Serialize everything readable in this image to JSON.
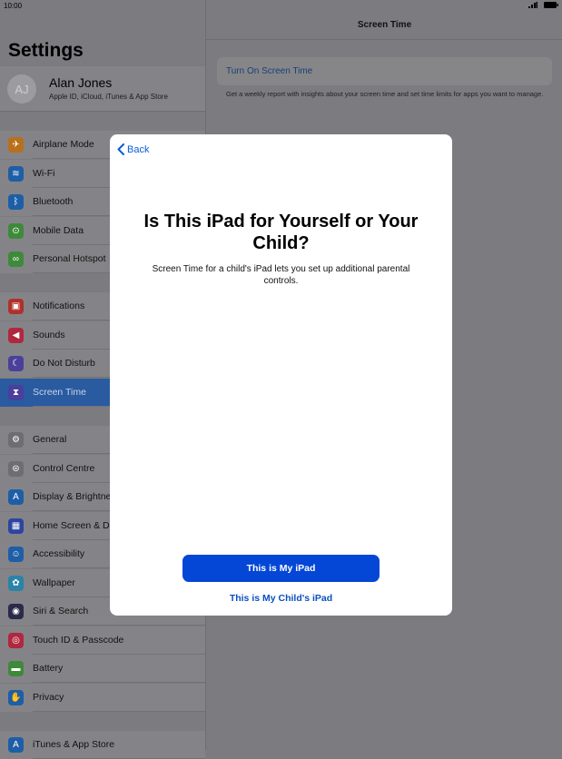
{
  "status": {
    "time": "10:00"
  },
  "sidebar": {
    "title": "Settings",
    "profile": {
      "initials": "AJ",
      "name": "Alan Jones",
      "subtitle": "Apple ID, iCloud, iTunes & App Store"
    },
    "items": [
      {
        "label": "Airplane Mode",
        "icon": "airplane-icon",
        "color": "#b8701a"
      },
      {
        "label": "Wi-Fi",
        "icon": "wifi-icon",
        "color": "#1e5ea6"
      },
      {
        "label": "Bluetooth",
        "icon": "bluetooth-icon",
        "color": "#1e5ea6"
      },
      {
        "label": "Mobile Data",
        "icon": "antenna-icon",
        "color": "#3f8a3a"
      },
      {
        "label": "Personal Hotspot",
        "icon": "hotspot-icon",
        "color": "#3f8a3a"
      },
      {
        "label": "Notifications",
        "icon": "notifications-icon",
        "color": "#b0302c"
      },
      {
        "label": "Sounds",
        "icon": "speaker-icon",
        "color": "#b0283e"
      },
      {
        "label": "Do Not Disturb",
        "icon": "moon-icon",
        "color": "#4a3f9a"
      },
      {
        "label": "Screen Time",
        "icon": "hourglass-icon",
        "color": "#4a3f9a"
      },
      {
        "label": "General",
        "icon": "gear-icon",
        "color": "#6e6e72"
      },
      {
        "label": "Control Centre",
        "icon": "switches-icon",
        "color": "#6e6e72"
      },
      {
        "label": "Display & Brightness",
        "icon": "display-icon",
        "color": "#1e5ea6"
      },
      {
        "label": "Home Screen & Dock",
        "icon": "grid-icon",
        "color": "#2c45a0"
      },
      {
        "label": "Accessibility",
        "icon": "accessibility-icon",
        "color": "#1e5ea6"
      },
      {
        "label": "Wallpaper",
        "icon": "flower-icon",
        "color": "#2a84a8"
      },
      {
        "label": "Siri & Search",
        "icon": "siri-icon",
        "color": "#2a2a4a"
      },
      {
        "label": "Touch ID & Passcode",
        "icon": "fingerprint-icon",
        "color": "#b0283e"
      },
      {
        "label": "Battery",
        "icon": "battery-icon",
        "color": "#3f8a3a"
      },
      {
        "label": "Privacy",
        "icon": "hand-icon",
        "color": "#1e5ea6"
      },
      {
        "label": "iTunes & App Store",
        "icon": "appstore-icon",
        "color": "#1e5ea6"
      }
    ]
  },
  "detail": {
    "title": "Screen Time",
    "turn_on": "Turn On Screen Time",
    "description": "Get a weekly report with insights about your screen time and set time limits for apps you want to manage."
  },
  "modal": {
    "back": "Back",
    "title": "Is This iPad for Yourself or Your Child?",
    "description": "Screen Time for a child's iPad lets you set up additional parental controls.",
    "primary": "This is My iPad",
    "secondary": "This is My Child's iPad"
  }
}
